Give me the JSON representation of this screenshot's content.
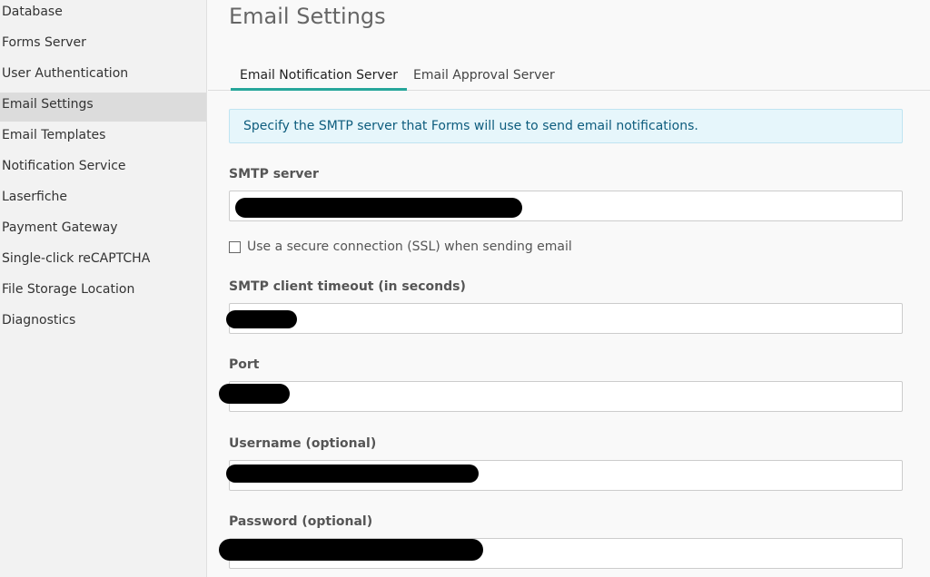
{
  "sidebar": {
    "items": [
      {
        "label": "Database",
        "active": false
      },
      {
        "label": "Forms Server",
        "active": false
      },
      {
        "label": "User Authentication",
        "active": false
      },
      {
        "label": "Email Settings",
        "active": true
      },
      {
        "label": "Email Templates",
        "active": false
      },
      {
        "label": "Notification Service",
        "active": false
      },
      {
        "label": "Laserfiche",
        "active": false
      },
      {
        "label": "Payment Gateway",
        "active": false
      },
      {
        "label": "Single-click reCAPTCHA",
        "active": false
      },
      {
        "label": "File Storage Location",
        "active": false
      },
      {
        "label": "Diagnostics",
        "active": false
      }
    ]
  },
  "main": {
    "title": "Email Settings",
    "tabs": [
      {
        "label": "Email Notification Server",
        "active": true
      },
      {
        "label": "Email Approval Server",
        "active": false
      }
    ],
    "info": "Specify the SMTP server that Forms will use to send email notifications.",
    "fields": {
      "smtp_server": {
        "label": "SMTP server",
        "value": ""
      },
      "ssl": {
        "label": "Use a secure connection (SSL) when sending email",
        "checked": false
      },
      "timeout": {
        "label": "SMTP client timeout (in seconds)",
        "value": ""
      },
      "port": {
        "label": "Port",
        "value": ""
      },
      "username": {
        "label": "Username (optional)",
        "value": ""
      },
      "password": {
        "label": "Password (optional)",
        "value": ""
      }
    }
  },
  "colors": {
    "accent": "#26a69a",
    "info_bg": "#e6f6fb",
    "info_text": "#0d5c7d",
    "sidebar_active": "#dcdcdc"
  }
}
